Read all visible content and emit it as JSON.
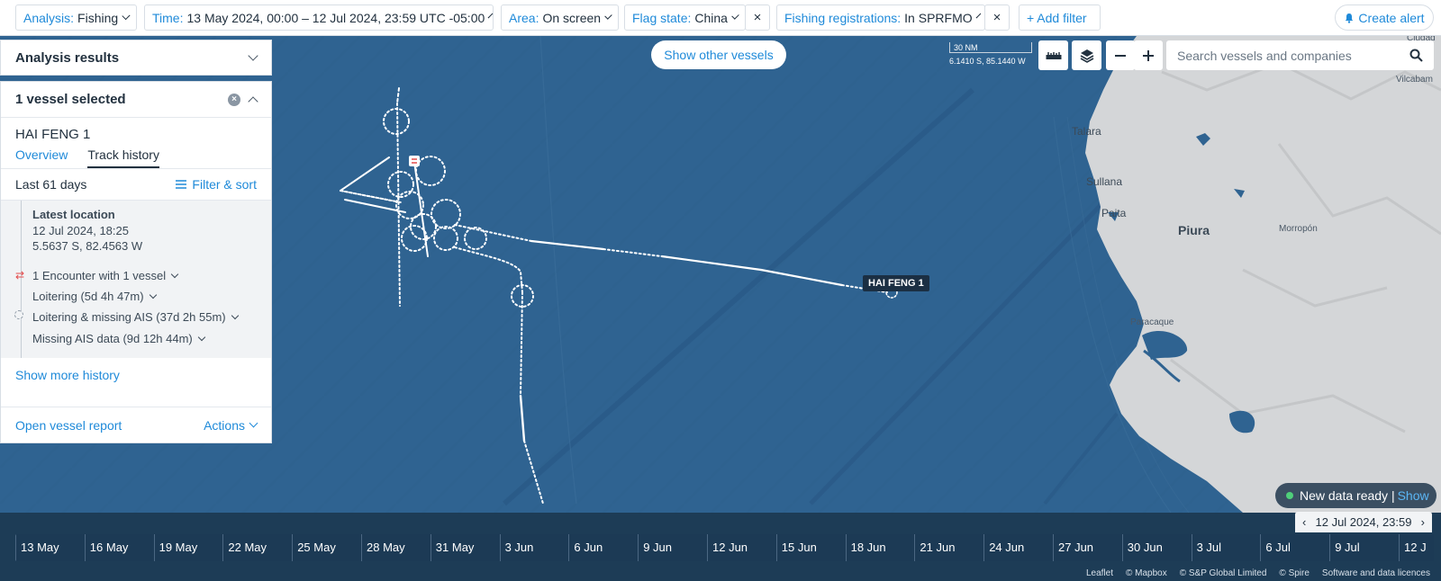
{
  "filters": {
    "analysis": {
      "key": "Analysis:",
      "value": "Fishing"
    },
    "time": {
      "key": "Time:",
      "value": "13 May 2024, 00:00 – 12 Jul 2024, 23:59 UTC -05:00"
    },
    "area": {
      "key": "Area:",
      "value": "On screen"
    },
    "flag": {
      "key": "Flag state:",
      "value": "China"
    },
    "registrations": {
      "key": "Fishing registrations:",
      "value": "In SPRFMO"
    },
    "add_filter": "+ Add filter",
    "create_alert": "Create alert",
    "remove_symbol": "×"
  },
  "analysis_panel": {
    "title": "Analysis results"
  },
  "vessel_panel": {
    "title": "1 vessel selected",
    "vessel_name": "HAI FENG 1",
    "tabs": [
      "Overview",
      "Track history"
    ],
    "period": "Last 61 days",
    "filter_sort": "Filter & sort",
    "latest": {
      "heading": "Latest location",
      "time": "12 Jul 2024, 18:25",
      "coords": "5.5637 S, 82.4563 W"
    },
    "events": [
      "1 Encounter with 1 vessel",
      "Loitering (5d 4h 47m)",
      "Loitering & missing AIS (37d 2h 55m)",
      "Missing AIS data (9d 12h 44m)"
    ],
    "show_more": "Show more history",
    "open_report": "Open vessel report",
    "actions": "Actions"
  },
  "map": {
    "show_other": "Show other vessels",
    "scale_label": "30 NM",
    "cursor_coords": "6.1410 S, 85.1440 W",
    "search_placeholder": "Search vessels and companies",
    "vessel_label": "HAI FENG 1",
    "places": [
      "Talara",
      "Sullana",
      "Paita",
      "Piura",
      "Morropón",
      "Paracaque",
      "Vilcabam",
      "Ciudad"
    ],
    "new_data": "New data ready",
    "new_data_sep": "|",
    "new_data_show": "Show",
    "colors": {
      "ocean": "#2f6391",
      "land": "#d4d6d8",
      "accent": "#1f8ad9"
    }
  },
  "timebar": {
    "current": "12 Jul 2024, 23:59",
    "ticks": [
      "13 May",
      "16 May",
      "19 May",
      "22 May",
      "25 May",
      "28 May",
      "31 May",
      "3 Jun",
      "6 Jun",
      "9 Jun",
      "12 Jun",
      "15 Jun",
      "18 Jun",
      "21 Jun",
      "24 Jun",
      "27 Jun",
      "30 Jun",
      "3 Jul",
      "6 Jul",
      "9 Jul",
      "12 J"
    ],
    "credits": [
      "Leaflet",
      "© Mapbox",
      "© S&P Global Limited",
      "© Spire",
      "Software and data licences"
    ]
  }
}
